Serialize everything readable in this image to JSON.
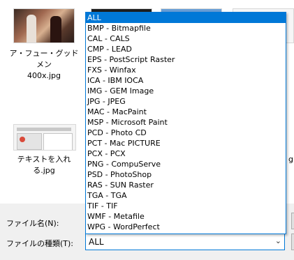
{
  "files": [
    {
      "name_line1": "ア・フュー・グッドメン",
      "name_line2": "400x.jpg"
    },
    {
      "name_line1": "テキストを入れる.jpg",
      "name_line2": ""
    },
    {
      "name_line1": "g",
      "name_line2": ""
    }
  ],
  "filename_label": "ファイル名(N):",
  "filetype_label": "ファイルの種類(T):",
  "filetype_combo": {
    "selected": "ALL",
    "arrow": "⌄",
    "options": [
      "ALL",
      "BMP - Bitmapfile",
      "CAL - CALS",
      "CMP - LEAD",
      "EPS - PostScript Raster",
      "FXS - Winfax",
      "ICA - IBM IOCA",
      "IMG - GEM Image",
      "JPG - JPEG",
      "MAC - MacPaint",
      "MSP - Microsoft Paint",
      "PCD - Photo CD",
      "PCT - Mac PICTURE",
      "PCX - PCX",
      "PNG - CompuServe",
      "PSD - PhotoShop",
      "RAS - SUN Raster",
      "TGA - TGA",
      "TIF - TIF",
      "WMF - Metafile",
      "WPG - WordPerfect"
    ]
  }
}
